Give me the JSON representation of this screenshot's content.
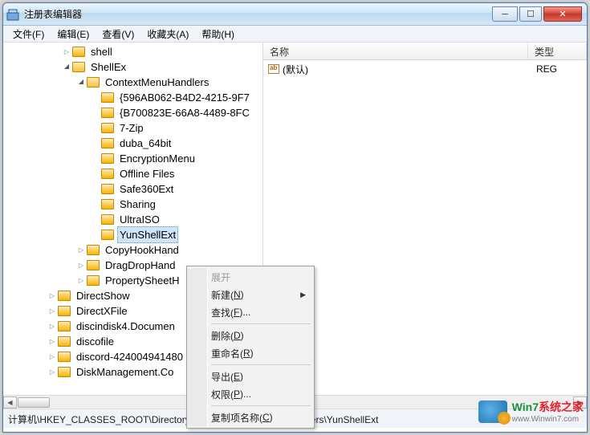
{
  "window": {
    "title": "注册表编辑器"
  },
  "menubar": [
    "文件(F)",
    "编辑(E)",
    "查看(V)",
    "收藏夹(A)",
    "帮助(H)"
  ],
  "tree": {
    "top": [
      {
        "label": "shell",
        "expand": "closed",
        "indent": 1
      },
      {
        "label": "ShellEx",
        "expand": "open",
        "indent": 1
      },
      {
        "label": "ContextMenuHandlers",
        "expand": "open",
        "indent": 2
      },
      {
        "label": "{596AB062-B4D2-4215-9F7",
        "expand": "none",
        "indent": 3
      },
      {
        "label": "{B700823E-66A8-4489-8FC",
        "expand": "none",
        "indent": 3
      },
      {
        "label": "7-Zip",
        "expand": "none",
        "indent": 3
      },
      {
        "label": "duba_64bit",
        "expand": "none",
        "indent": 3
      },
      {
        "label": "EncryptionMenu",
        "expand": "none",
        "indent": 3
      },
      {
        "label": "Offline Files",
        "expand": "none",
        "indent": 3
      },
      {
        "label": "Safe360Ext",
        "expand": "none",
        "indent": 3
      },
      {
        "label": "Sharing",
        "expand": "none",
        "indent": 3
      },
      {
        "label": "UltraISO",
        "expand": "none",
        "indent": 3
      },
      {
        "label": "YunShellExt",
        "expand": "none",
        "indent": 3,
        "selected": true
      },
      {
        "label": "CopyHookHand",
        "expand": "closed",
        "indent": 2
      },
      {
        "label": "DragDropHand",
        "expand": "closed",
        "indent": 2
      },
      {
        "label": "PropertySheetH",
        "expand": "closed",
        "indent": 2
      },
      {
        "label": "DirectShow",
        "expand": "closed",
        "indent": "0b"
      },
      {
        "label": "DirectXFile",
        "expand": "closed",
        "indent": "0b"
      },
      {
        "label": "discindisk4.Documen",
        "expand": "closed",
        "indent": "0b"
      },
      {
        "label": "discofile",
        "expand": "closed",
        "indent": "0b"
      },
      {
        "label": "discord-424004941480",
        "expand": "closed",
        "indent": "0b"
      },
      {
        "label": "DiskManagement.Co",
        "expand": "closed",
        "indent": "0b"
      }
    ]
  },
  "list": {
    "columns": {
      "name": "名称",
      "type": "类型"
    },
    "rows": [
      {
        "name": "(默认)",
        "type": "REG"
      }
    ]
  },
  "context_menu": [
    {
      "label": "展开",
      "disabled": true
    },
    {
      "label_html": "新建(<u>N</u>)",
      "submenu": true
    },
    {
      "label_html": "查找(<u>F</u>)..."
    },
    {
      "sep": true
    },
    {
      "label_html": "删除(<u>D</u>)"
    },
    {
      "label_html": "重命名(<u>R</u>)"
    },
    {
      "sep": true
    },
    {
      "label_html": "导出(<u>E</u>)"
    },
    {
      "label_html": "权限(<u>P</u>)..."
    },
    {
      "sep": true
    },
    {
      "label_html": "复制项名称(<u>C</u>)"
    }
  ],
  "statusbar": "计算机\\HKEY_CLASSES_ROOT\\Directory\\ShellEx\\ContextMenuHandlers\\YunShellExt",
  "watermark": {
    "brand_html": "<span class='w7'>Win7</span>系统之家",
    "url": "www.Winwin7.com"
  }
}
